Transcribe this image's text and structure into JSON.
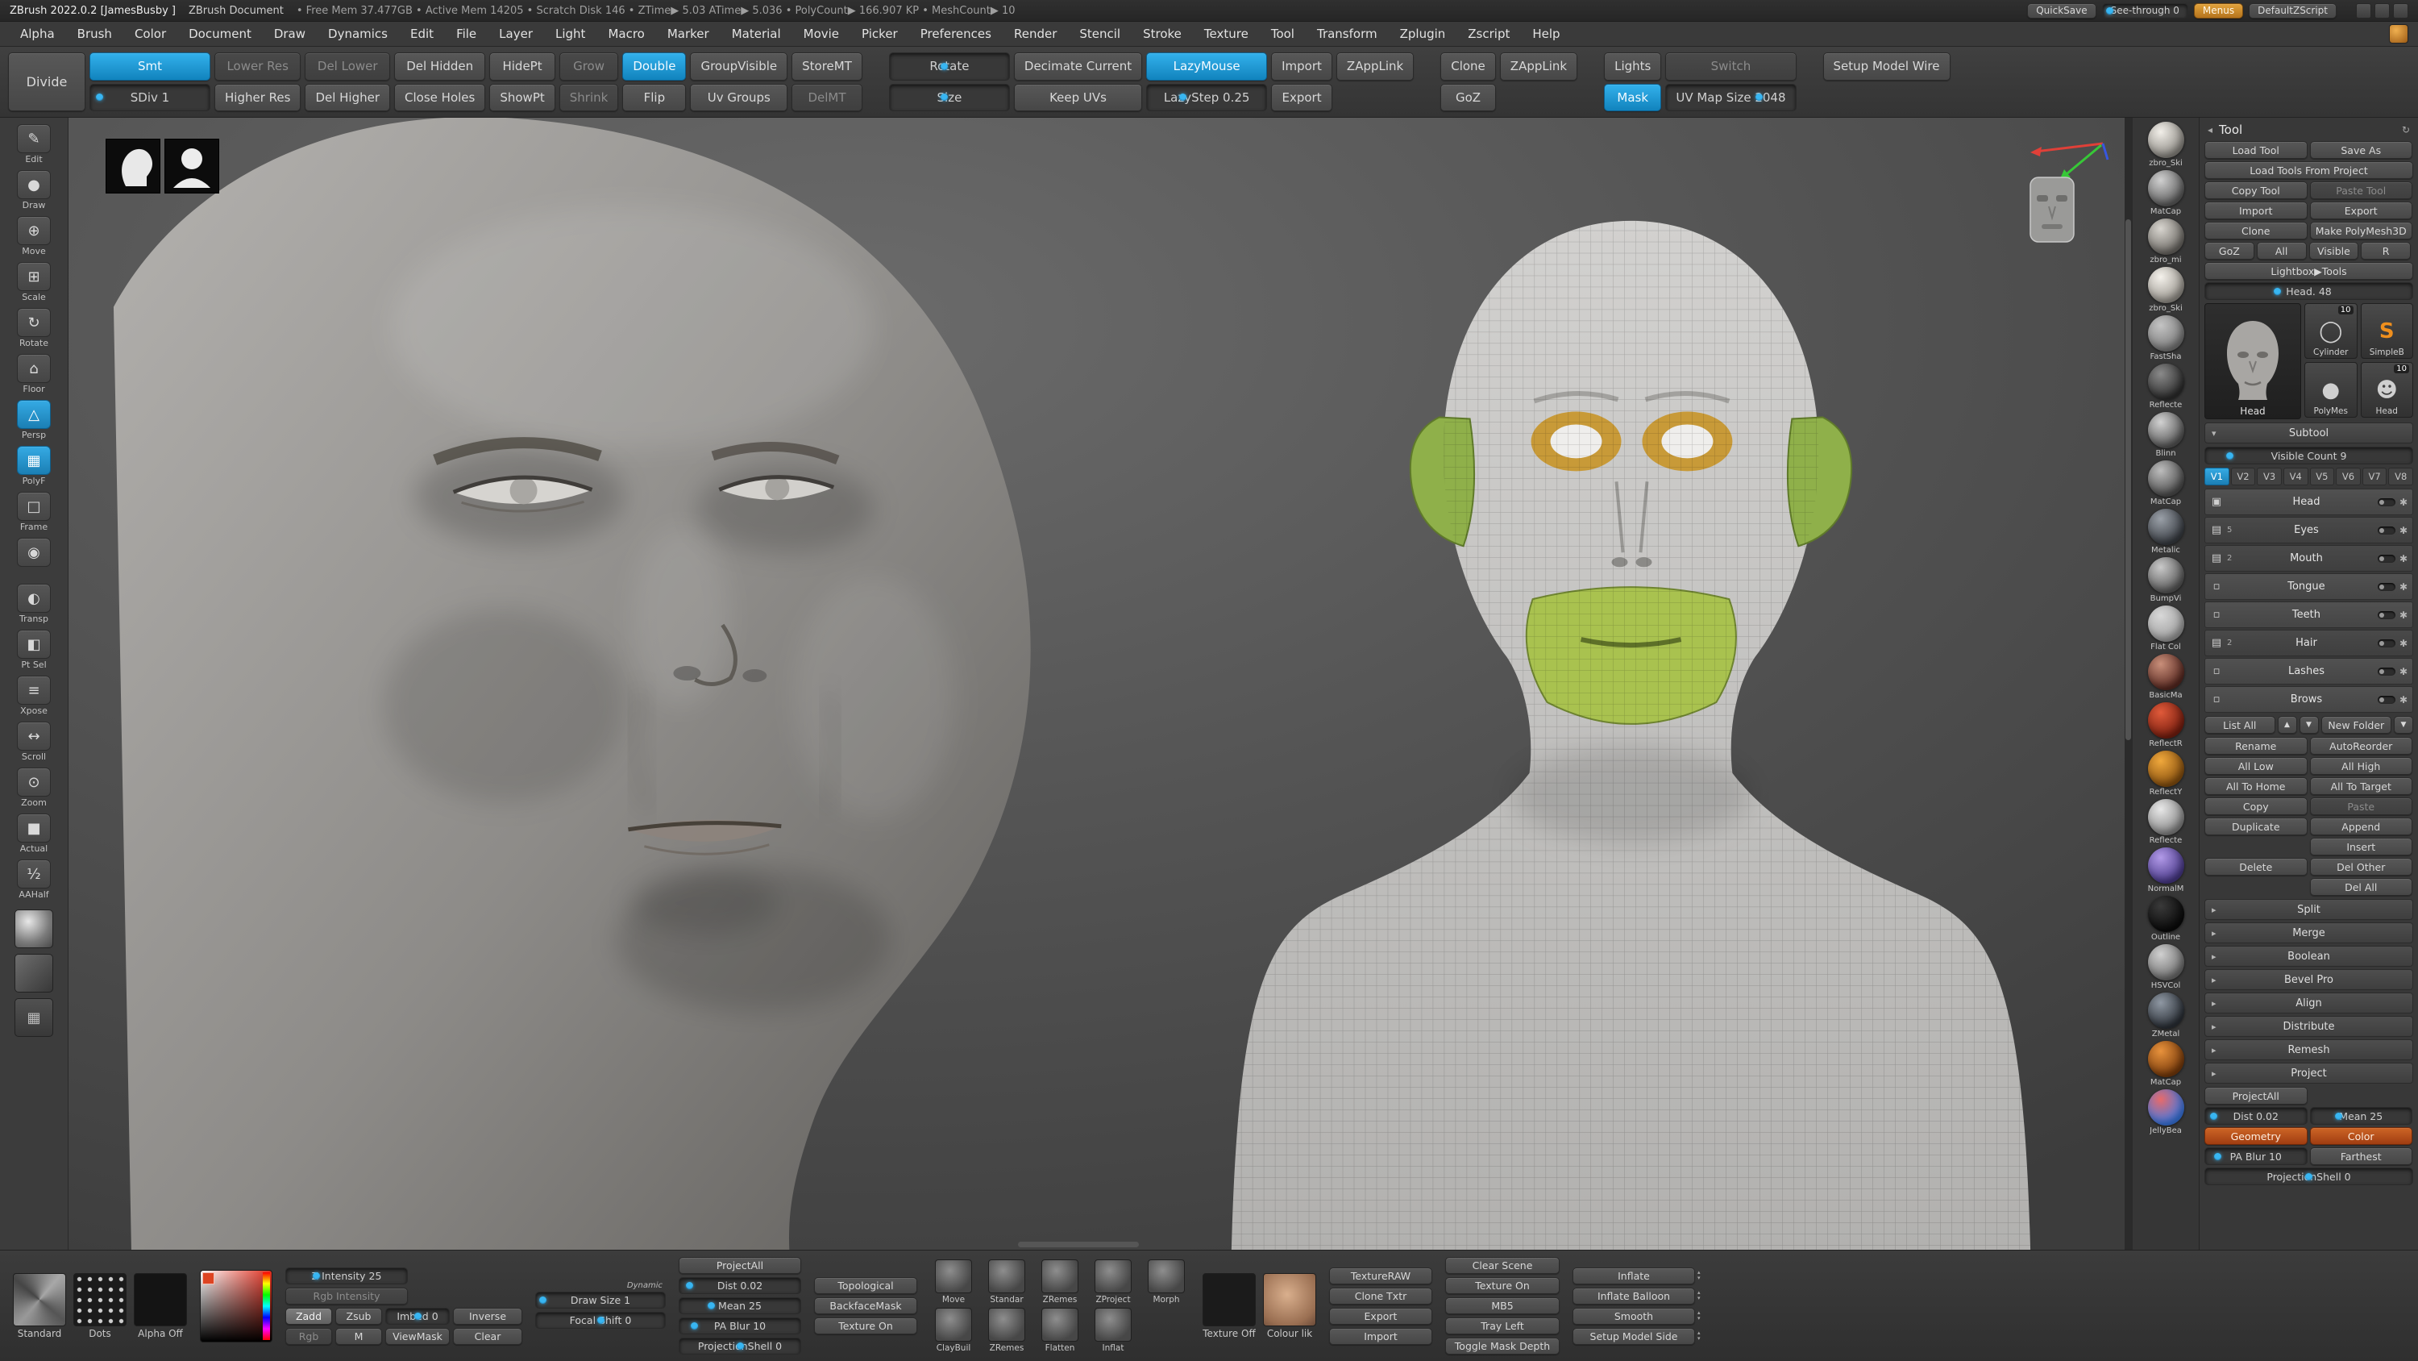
{
  "icons": {
    "caret_right": "▸",
    "caret_down": "▾",
    "up": "▲",
    "down": "▼",
    "tiny_up": "▴",
    "tiny_down": "▾",
    "gear": "✱",
    "collapse": "◂",
    "restore": "↻"
  },
  "colors": {
    "accent_blue": "#1f9ad6",
    "accent_orange": "#c98a2e",
    "project_toggle_orange": "#b5551d",
    "polygroup_green": "#a9c24f",
    "eye_socket_gold": "#c89a38"
  },
  "title_bar": {
    "app": "ZBrush 2022.0.2 [JamesBusby ]",
    "doc": "ZBrush Document",
    "stats": "• Free Mem 37.477GB   • Active Mem 14205   • Scratch Disk 146 •   ZTime▶ 5.03  ATime▶ 5.036   • PolyCount▶ 166.907 KP   • MeshCount▶ 10",
    "buttons": [
      {
        "t": "QuickSave",
        "v": "default"
      },
      {
        "t": "See-through 0",
        "v": "slider",
        "pos": "8%"
      },
      {
        "t": "Menus",
        "v": "orange"
      },
      {
        "t": "DefaultZScript",
        "v": "default"
      }
    ]
  },
  "menu_bar": {
    "items": [
      "Alpha",
      "Brush",
      "Color",
      "Document",
      "Draw",
      "Dynamics",
      "Edit",
      "File",
      "Layer",
      "Light",
      "Macro",
      "Marker",
      "Material",
      "Movie",
      "Picker",
      "Preferences",
      "Render",
      "Stencil",
      "Stroke",
      "Texture",
      "Tool",
      "Transform",
      "Zplugin",
      "Zscript",
      "Help"
    ]
  },
  "top_toolbar": {
    "divide": "Divide",
    "pairs": [
      {
        "gap": "0",
        "top": {
          "t": "Smt",
          "v": "blue",
          "pos": ""
        },
        "bot": {
          "t": "SDiv 1",
          "v": "slider",
          "pos": "8%"
        }
      },
      {
        "gap": "0",
        "top": {
          "t": "Lower Res",
          "v": "dim",
          "pos": ""
        },
        "bot": {
          "t": "Higher Res",
          "v": "default",
          "pos": ""
        }
      },
      {
        "gap": "0",
        "top": {
          "t": "Del Lower",
          "v": "dim",
          "pos": ""
        },
        "bot": {
          "t": "Del Higher",
          "v": "default",
          "pos": ""
        }
      },
      {
        "gap": "0",
        "top": {
          "t": "Del Hidden",
          "v": "default",
          "pos": ""
        },
        "bot": {
          "t": "Close Holes",
          "v": "default",
          "pos": ""
        }
      },
      {
        "gap": "0",
        "top": {
          "t": "HidePt",
          "v": "default",
          "pos": ""
        },
        "bot": {
          "t": "ShowPt",
          "v": "default",
          "pos": ""
        }
      },
      {
        "gap": "0",
        "top": {
          "t": "Grow",
          "v": "dim",
          "pos": ""
        },
        "bot": {
          "t": "Shrink",
          "v": "dim",
          "pos": ""
        }
      },
      {
        "gap": "0",
        "top": {
          "t": "Double",
          "v": "blue",
          "pos": ""
        },
        "bot": {
          "t": "Flip",
          "v": "default",
          "pos": ""
        }
      },
      {
        "gap": "0",
        "top": {
          "t": "GroupVisible",
          "v": "default",
          "pos": ""
        },
        "bot": {
          "t": "Uv Groups",
          "v": "default",
          "pos": ""
        }
      },
      {
        "gap": "0",
        "top": {
          "t": "StoreMT",
          "v": "default",
          "pos": ""
        },
        "bot": {
          "t": "DelMT",
          "v": "dim",
          "pos": ""
        }
      },
      {
        "gap": "1",
        "top": {
          "t": "Rotate",
          "v": "slider",
          "pos": "46%"
        },
        "bot": {
          "t": "Size",
          "v": "slider",
          "pos": "46%"
        }
      },
      {
        "gap": "0",
        "top": {
          "t": "Decimate Current",
          "v": "default",
          "pos": ""
        },
        "bot": {
          "t": "Keep UVs",
          "v": "default",
          "pos": ""
        }
      },
      {
        "gap": "0",
        "top": {
          "t": "LazyMouse",
          "v": "blue",
          "pos": ""
        },
        "bot": {
          "t": "LazyStep 0.25",
          "v": "slider",
          "pos": "30%"
        }
      },
      {
        "gap": "0",
        "top": {
          "t": "Import",
          "v": "default",
          "pos": ""
        },
        "bot": {
          "t": "Export",
          "v": "default",
          "pos": ""
        }
      },
      {
        "gap": "0",
        "top": {
          "t": "ZAppLink",
          "v": "default",
          "pos": ""
        },
        "bot": {
          "t": "",
          "v": "none",
          "pos": ""
        }
      },
      {
        "gap": "1",
        "top": {
          "t": "Clone",
          "v": "default",
          "pos": ""
        },
        "bot": {
          "t": "GoZ",
          "v": "default",
          "pos": ""
        }
      },
      {
        "gap": "0",
        "top": {
          "t": "ZAppLink",
          "v": "default",
          "pos": ""
        },
        "bot": {
          "t": "",
          "v": "none",
          "pos": ""
        }
      },
      {
        "gap": "1",
        "top": {
          "t": "Lights",
          "v": "default",
          "pos": ""
        },
        "bot": {
          "t": "Mask",
          "v": "blue",
          "pos": ""
        }
      },
      {
        "gap": "0",
        "top": {
          "t": "Switch",
          "v": "dim",
          "pos": ""
        },
        "bot": {
          "t": "UV Map Size 2048",
          "v": "slider",
          "pos": "72%"
        }
      },
      {
        "gap": "1",
        "top": {
          "t": "Setup Model Wire",
          "v": "default",
          "pos": ""
        },
        "bot": {
          "t": "",
          "v": "none",
          "pos": ""
        }
      }
    ]
  },
  "left_toolbar": {
    "items": [
      {
        "icon": "✎",
        "label": "Edit",
        "active": "0"
      },
      {
        "icon": "●",
        "label": "Draw",
        "active": "0"
      },
      {
        "icon": "⊕",
        "label": "Move",
        "active": "0"
      },
      {
        "icon": "⊞",
        "label": "Scale",
        "active": "0"
      },
      {
        "icon": "↻",
        "label": "Rotate",
        "active": "0"
      },
      {
        "icon": "⌂",
        "label": "Floor",
        "active": "0"
      },
      {
        "icon": "△",
        "label": "Persp",
        "active": "1"
      },
      {
        "icon": "▦",
        "label": "PolyF",
        "active": "1"
      },
      {
        "icon": "□",
        "label": "Frame",
        "active": "0"
      },
      {
        "icon": "◉",
        "label": "",
        "active": "0"
      },
      {
        "icon": "◐",
        "label": "Transp",
        "active": "0"
      },
      {
        "icon": "◧",
        "label": "Pt Sel",
        "active": "0"
      },
      {
        "icon": "≡",
        "label": "Xpose",
        "active": "0"
      },
      {
        "icon": "↔",
        "label": "Scroll",
        "active": "0"
      },
      {
        "icon": "⊙",
        "label": "Zoom",
        "active": "0"
      },
      {
        "icon": "■",
        "label": "Actual",
        "active": "0"
      },
      {
        "icon": "½",
        "label": "AAHalf",
        "active": "0"
      }
    ]
  },
  "materials": {
    "items": [
      {
        "label": "zbro_Ski",
        "c1": "#f2efe9",
        "c2": "#8d8a84"
      },
      {
        "label": "MatCap",
        "c1": "#d0d0d0",
        "c2": "#5f5f5f"
      },
      {
        "label": "zbro_mi",
        "c1": "#d8d5cf",
        "c2": "#6e6b66"
      },
      {
        "label": "zbro_Ski",
        "c1": "#f5f2ec",
        "c2": "#9a968f"
      },
      {
        "label": "FastSha",
        "c1": "#c4c4c4",
        "c2": "#7a7a7a"
      },
      {
        "label": "Reflecte",
        "c1": "#8a8a8a",
        "c2": "#2e2e2e"
      },
      {
        "label": "Blinn",
        "c1": "#d2d2d2",
        "c2": "#585858"
      },
      {
        "label": "MatCap",
        "c1": "#bdbdbd",
        "c2": "#4f4f4f"
      },
      {
        "label": "Metalic",
        "c1": "#9aa0a8",
        "c2": "#3a3e44"
      },
      {
        "label": "BumpVi",
        "c1": "#c9c9c9",
        "c2": "#5a5a5a"
      },
      {
        "label": "Flat Col",
        "c1": "#d8d8d8",
        "c2": "#9f9f9f"
      },
      {
        "label": "BasicMa",
        "c1": "#c98f7a",
        "c2": "#5a2a22"
      },
      {
        "label": "ReflectR",
        "c1": "#e05a3a",
        "c2": "#7a1f10"
      },
      {
        "label": "ReflectY",
        "c1": "#f0a83c",
        "c2": "#8a5210"
      },
      {
        "label": "Reflecte",
        "c1": "#e8e8e8",
        "c2": "#888888"
      },
      {
        "label": "NormalM",
        "c1": "#b29ae8",
        "c2": "#4a3a8a"
      },
      {
        "label": "Outline",
        "c1": "#3a3a3a",
        "c2": "#0a0a0a"
      },
      {
        "label": "HSVCol",
        "c1": "#d0d0d0",
        "c2": "#707070"
      },
      {
        "label": "ZMetal",
        "c1": "#8f98a3",
        "c2": "#2c3138"
      },
      {
        "label": "MatCap",
        "c1": "#e8923c",
        "c2": "#7a3c0c"
      },
      {
        "label": "JellyBea",
        "c1": "#e86a6a",
        "c2": "#3c7ae8"
      }
    ]
  },
  "tool_panel": {
    "title": "Tool",
    "top_buttons": [
      {
        "t": "Load Tool",
        "w": "half",
        "v": "default",
        "pos": ""
      },
      {
        "t": "Save As",
        "w": "half",
        "v": "default",
        "pos": ""
      },
      {
        "t": "Load Tools From Project",
        "w": "full",
        "v": "default",
        "pos": ""
      },
      {
        "t": "Copy Tool",
        "w": "half",
        "v": "default",
        "pos": ""
      },
      {
        "t": "Paste Tool",
        "w": "half",
        "v": "dim",
        "pos": ""
      },
      {
        "t": "Import",
        "w": "half",
        "v": "default",
        "pos": ""
      },
      {
        "t": "Export",
        "w": "half",
        "v": "default",
        "pos": ""
      },
      {
        "t": "Clone",
        "w": "half",
        "v": "default",
        "pos": ""
      },
      {
        "t": "Make PolyMesh3D",
        "w": "half",
        "v": "default",
        "pos": ""
      },
      {
        "t": "GoZ",
        "w": "quarter",
        "v": "default",
        "pos": ""
      },
      {
        "t": "All",
        "w": "quarter",
        "v": "default",
        "pos": ""
      },
      {
        "t": "Visible",
        "w": "quarter",
        "v": "default",
        "pos": ""
      },
      {
        "t": "R",
        "w": "quarter",
        "v": "default",
        "pos": ""
      },
      {
        "t": "Lightbox▶Tools",
        "w": "full",
        "v": "default",
        "pos": ""
      },
      {
        "t": "Head. 48",
        "w": "full",
        "v": "slider",
        "pos": "35%"
      }
    ],
    "thumbs": {
      "active_label": "Head",
      "items": [
        {
          "label": "Cylinder",
          "badge": "10",
          "glyph": "◯"
        },
        {
          "label": "SimpleB",
          "badge": "",
          "glyph": "S"
        },
        {
          "label": "PolyMes",
          "badge": "",
          "glyph": "●"
        },
        {
          "label": "Head",
          "badge": "10",
          "glyph": "☻"
        }
      ]
    },
    "subtool": {
      "header": "Subtool",
      "visible_count": {
        "t": "Visible Count 9",
        "pos": "12%"
      },
      "tabs": [
        {
          "t": "V1",
          "a": "1"
        },
        {
          "t": "V2",
          "a": "0"
        },
        {
          "t": "V3",
          "a": "0"
        },
        {
          "t": "V4",
          "a": "0"
        },
        {
          "t": "V5",
          "a": "0"
        },
        {
          "t": "V6",
          "a": "0"
        },
        {
          "t": "V7",
          "a": "0"
        },
        {
          "t": "V8",
          "a": "0"
        }
      ],
      "rows": [
        {
          "label": "Head",
          "kind": "item",
          "icon": "▣",
          "count": ""
        },
        {
          "label": "Eyes",
          "kind": "folder",
          "icon": "▤",
          "count": "5"
        },
        {
          "label": "Mouth",
          "kind": "folder",
          "icon": "▤",
          "count": "2"
        },
        {
          "label": "Tongue",
          "kind": "item",
          "icon": "▫",
          "count": ""
        },
        {
          "label": "Teeth",
          "kind": "item",
          "icon": "▫",
          "count": ""
        },
        {
          "label": "Hair",
          "kind": "folder",
          "icon": "▤",
          "count": "2"
        },
        {
          "label": "Lashes",
          "kind": "item",
          "icon": "▫",
          "count": ""
        },
        {
          "label": "Brows",
          "kind": "item",
          "icon": "▫",
          "count": ""
        }
      ],
      "list_all": "List All",
      "new_folder": "New Folder",
      "buttons": [
        {
          "t": "Rename",
          "v": "default",
          "pos": ""
        },
        {
          "t": "AutoReorder",
          "v": "default",
          "pos": ""
        },
        {
          "t": "All Low",
          "v": "default",
          "pos": ""
        },
        {
          "t": "All High",
          "v": "default",
          "pos": ""
        },
        {
          "t": "All To Home",
          "v": "default",
          "pos": ""
        },
        {
          "t": "All To Target",
          "v": "default",
          "pos": ""
        },
        {
          "t": "Copy",
          "v": "default",
          "pos": ""
        },
        {
          "t": "Paste",
          "v": "dim",
          "pos": ""
        },
        {
          "t": "Duplicate",
          "v": "default",
          "pos": ""
        },
        {
          "t": "Append",
          "v": "default",
          "pos": ""
        },
        {
          "t": "",
          "v": "none",
          "pos": ""
        },
        {
          "t": "Insert",
          "v": "default",
          "pos": ""
        },
        {
          "t": "Delete",
          "v": "default",
          "pos": ""
        },
        {
          "t": "Del Other",
          "v": "default",
          "pos": ""
        },
        {
          "t": "",
          "v": "none",
          "pos": ""
        },
        {
          "t": "Del All",
          "v": "default",
          "pos": ""
        }
      ],
      "section_headers": [
        "Split",
        "Merge",
        "Boolean",
        "Bevel Pro",
        "Align",
        "Distribute",
        "Remesh",
        "Project"
      ],
      "project_buttons": [
        {
          "t": "ProjectAll",
          "w": "half",
          "v": "default",
          "pos": ""
        },
        {
          "t": "",
          "w": "half",
          "v": "none",
          "pos": ""
        },
        {
          "t": "Dist 0.02",
          "w": "half",
          "v": "slider",
          "pos": "8%"
        },
        {
          "t": "Mean 25",
          "w": "half",
          "v": "slider",
          "pos": "28%"
        },
        {
          "t": "Geometry",
          "w": "half",
          "v": "redor",
          "pos": ""
        },
        {
          "t": "Color",
          "w": "half",
          "v": "redor",
          "pos": ""
        },
        {
          "t": "PA Blur 10",
          "w": "half",
          "v": "slider",
          "pos": "12%"
        },
        {
          "t": "Farthest",
          "w": "half",
          "v": "default",
          "pos": ""
        },
        {
          "t": "ProjectionShell 0",
          "w": "full",
          "v": "slider",
          "pos": "50%"
        }
      ]
    }
  },
  "bottom_bar": {
    "thumbs": [
      {
        "label": "Standard",
        "kind": "brush"
      },
      {
        "label": "Dots",
        "kind": "stroke"
      },
      {
        "label": "Alpha Off",
        "kind": "alpha"
      }
    ],
    "intensity_sliders": [
      {
        "t": "Z Intensity 25",
        "v": "slider",
        "pos": "25%"
      },
      {
        "t": "Rgb Intensity",
        "v": "dim",
        "pos": ""
      }
    ],
    "mode_buttons": [
      {
        "t": "Zadd",
        "v": "active",
        "pos": ""
      },
      {
        "t": "Zsub",
        "v": "default",
        "pos": ""
      },
      {
        "t": "Imbed 0",
        "v": "slider",
        "pos": "50%"
      },
      {
        "t": "Inverse",
        "v": "default",
        "pos": ""
      },
      {
        "t": "Rgb",
        "v": "dim",
        "pos": ""
      },
      {
        "t": "M",
        "v": "default",
        "pos": ""
      },
      {
        "t": "ViewMask",
        "v": "default",
        "pos": ""
      },
      {
        "t": "Clear",
        "v": "default",
        "pos": ""
      }
    ],
    "dynamic_label": "Dynamic",
    "draw_sliders": [
      {
        "t": "Draw Size 1",
        "v": "slider",
        "pos": "5%"
      },
      {
        "t": "Focal Shift 0",
        "v": "slider",
        "pos": "50%"
      }
    ],
    "project_buttons": [
      {
        "t": "ProjectAll",
        "v": "default",
        "pos": ""
      },
      {
        "t": "Dist 0.02",
        "v": "slider",
        "pos": "8%"
      },
      {
        "t": "Mean 25",
        "v": "slider",
        "pos": "26%"
      },
      {
        "t": "PA Blur 10",
        "v": "slider",
        "pos": "12%"
      },
      {
        "t": "ProjectionShell 0",
        "v": "slider",
        "pos": "50%"
      }
    ],
    "toggle_buttons": [
      "Topological",
      "BackfaceMask",
      "Texture On"
    ],
    "brush_icons": [
      {
        "label": "Move"
      },
      {
        "label": "Standar"
      },
      {
        "label": "ZRemes"
      },
      {
        "label": "ZProject"
      },
      {
        "label": "Morph"
      },
      {
        "label": "ClayBuil"
      },
      {
        "label": "ZRemes"
      },
      {
        "label": "Flatten"
      },
      {
        "label": "Inflat"
      }
    ],
    "texture_thumbs": [
      {
        "label": "Texture Off",
        "kind": "off"
      },
      {
        "label": "Colour lik",
        "kind": "face"
      }
    ],
    "texture_buttons": [
      "TextureRAW",
      "Clone Txtr",
      "Export",
      "Import"
    ],
    "scene_buttons": [
      "Clear Scene",
      "Texture On",
      "MB5",
      "Tray Left",
      "Toggle Mask Depth"
    ],
    "inflate_buttons": [
      "Inflate",
      "Inflate Balloon",
      "Smooth",
      "Setup Model Side"
    ]
  }
}
